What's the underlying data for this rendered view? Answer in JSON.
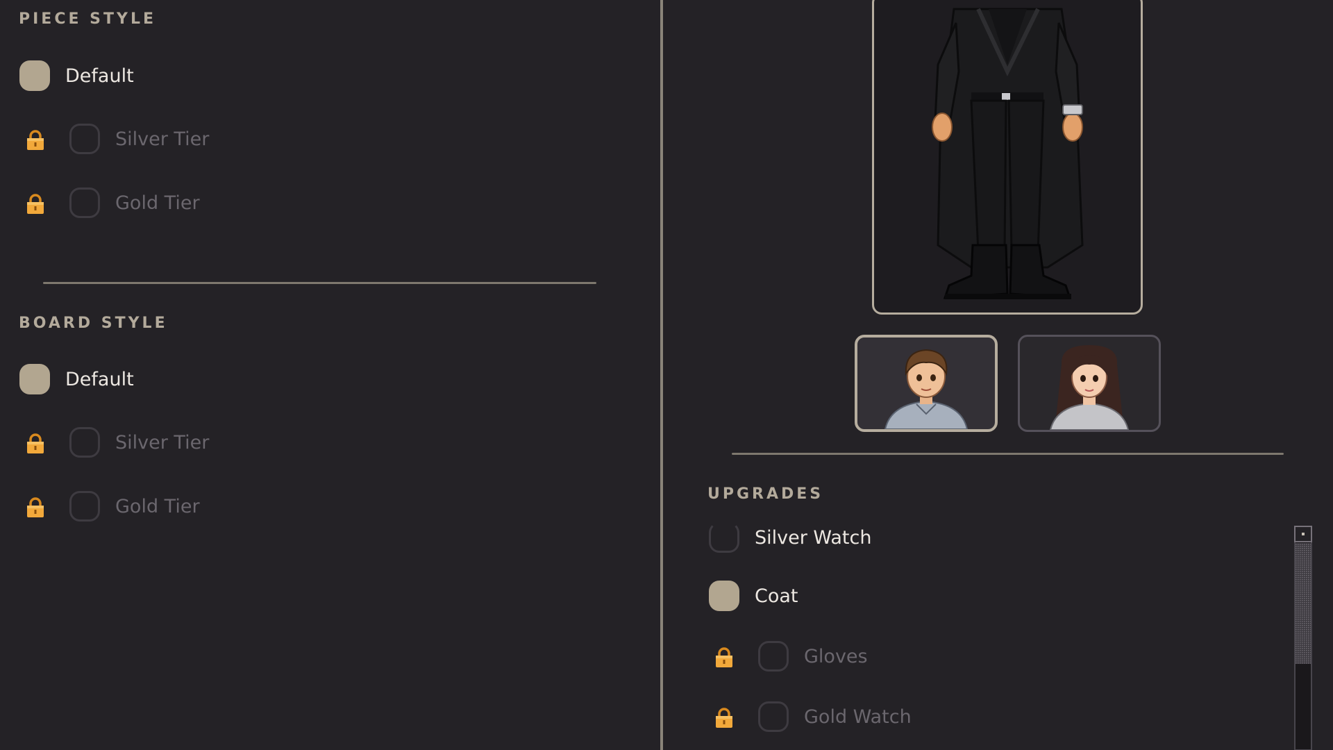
{
  "piece_style": {
    "title": "PIECE STYLE",
    "options": [
      {
        "label": "Default",
        "state": "selected",
        "locked": false
      },
      {
        "label": "Silver Tier",
        "state": "unselected",
        "locked": true
      },
      {
        "label": "Gold Tier",
        "state": "unselected",
        "locked": true
      }
    ]
  },
  "board_style": {
    "title": "BOARD STYLE",
    "options": [
      {
        "label": "Default",
        "state": "selected",
        "locked": false
      },
      {
        "label": "Silver Tier",
        "state": "unselected",
        "locked": true
      },
      {
        "label": "Gold Tier",
        "state": "unselected",
        "locked": true
      }
    ]
  },
  "character": {
    "preview": "character-figure-black-coat",
    "avatars": [
      {
        "name": "male-avatar",
        "selected": true
      },
      {
        "name": "female-avatar",
        "selected": false
      }
    ]
  },
  "upgrades": {
    "title": "UPGRADES",
    "items": [
      {
        "label": "Silver Watch",
        "state": "unselected",
        "locked": false
      },
      {
        "label": "Coat",
        "state": "selected",
        "locked": false
      },
      {
        "label": "Gloves",
        "state": "unselected",
        "locked": true
      },
      {
        "label": "Gold Watch",
        "state": "unselected",
        "locked": true
      }
    ]
  },
  "colors": {
    "background": "#242226",
    "accent": "#b2a690",
    "lock": "#f2a93b",
    "locked_text": "#6b676e"
  }
}
